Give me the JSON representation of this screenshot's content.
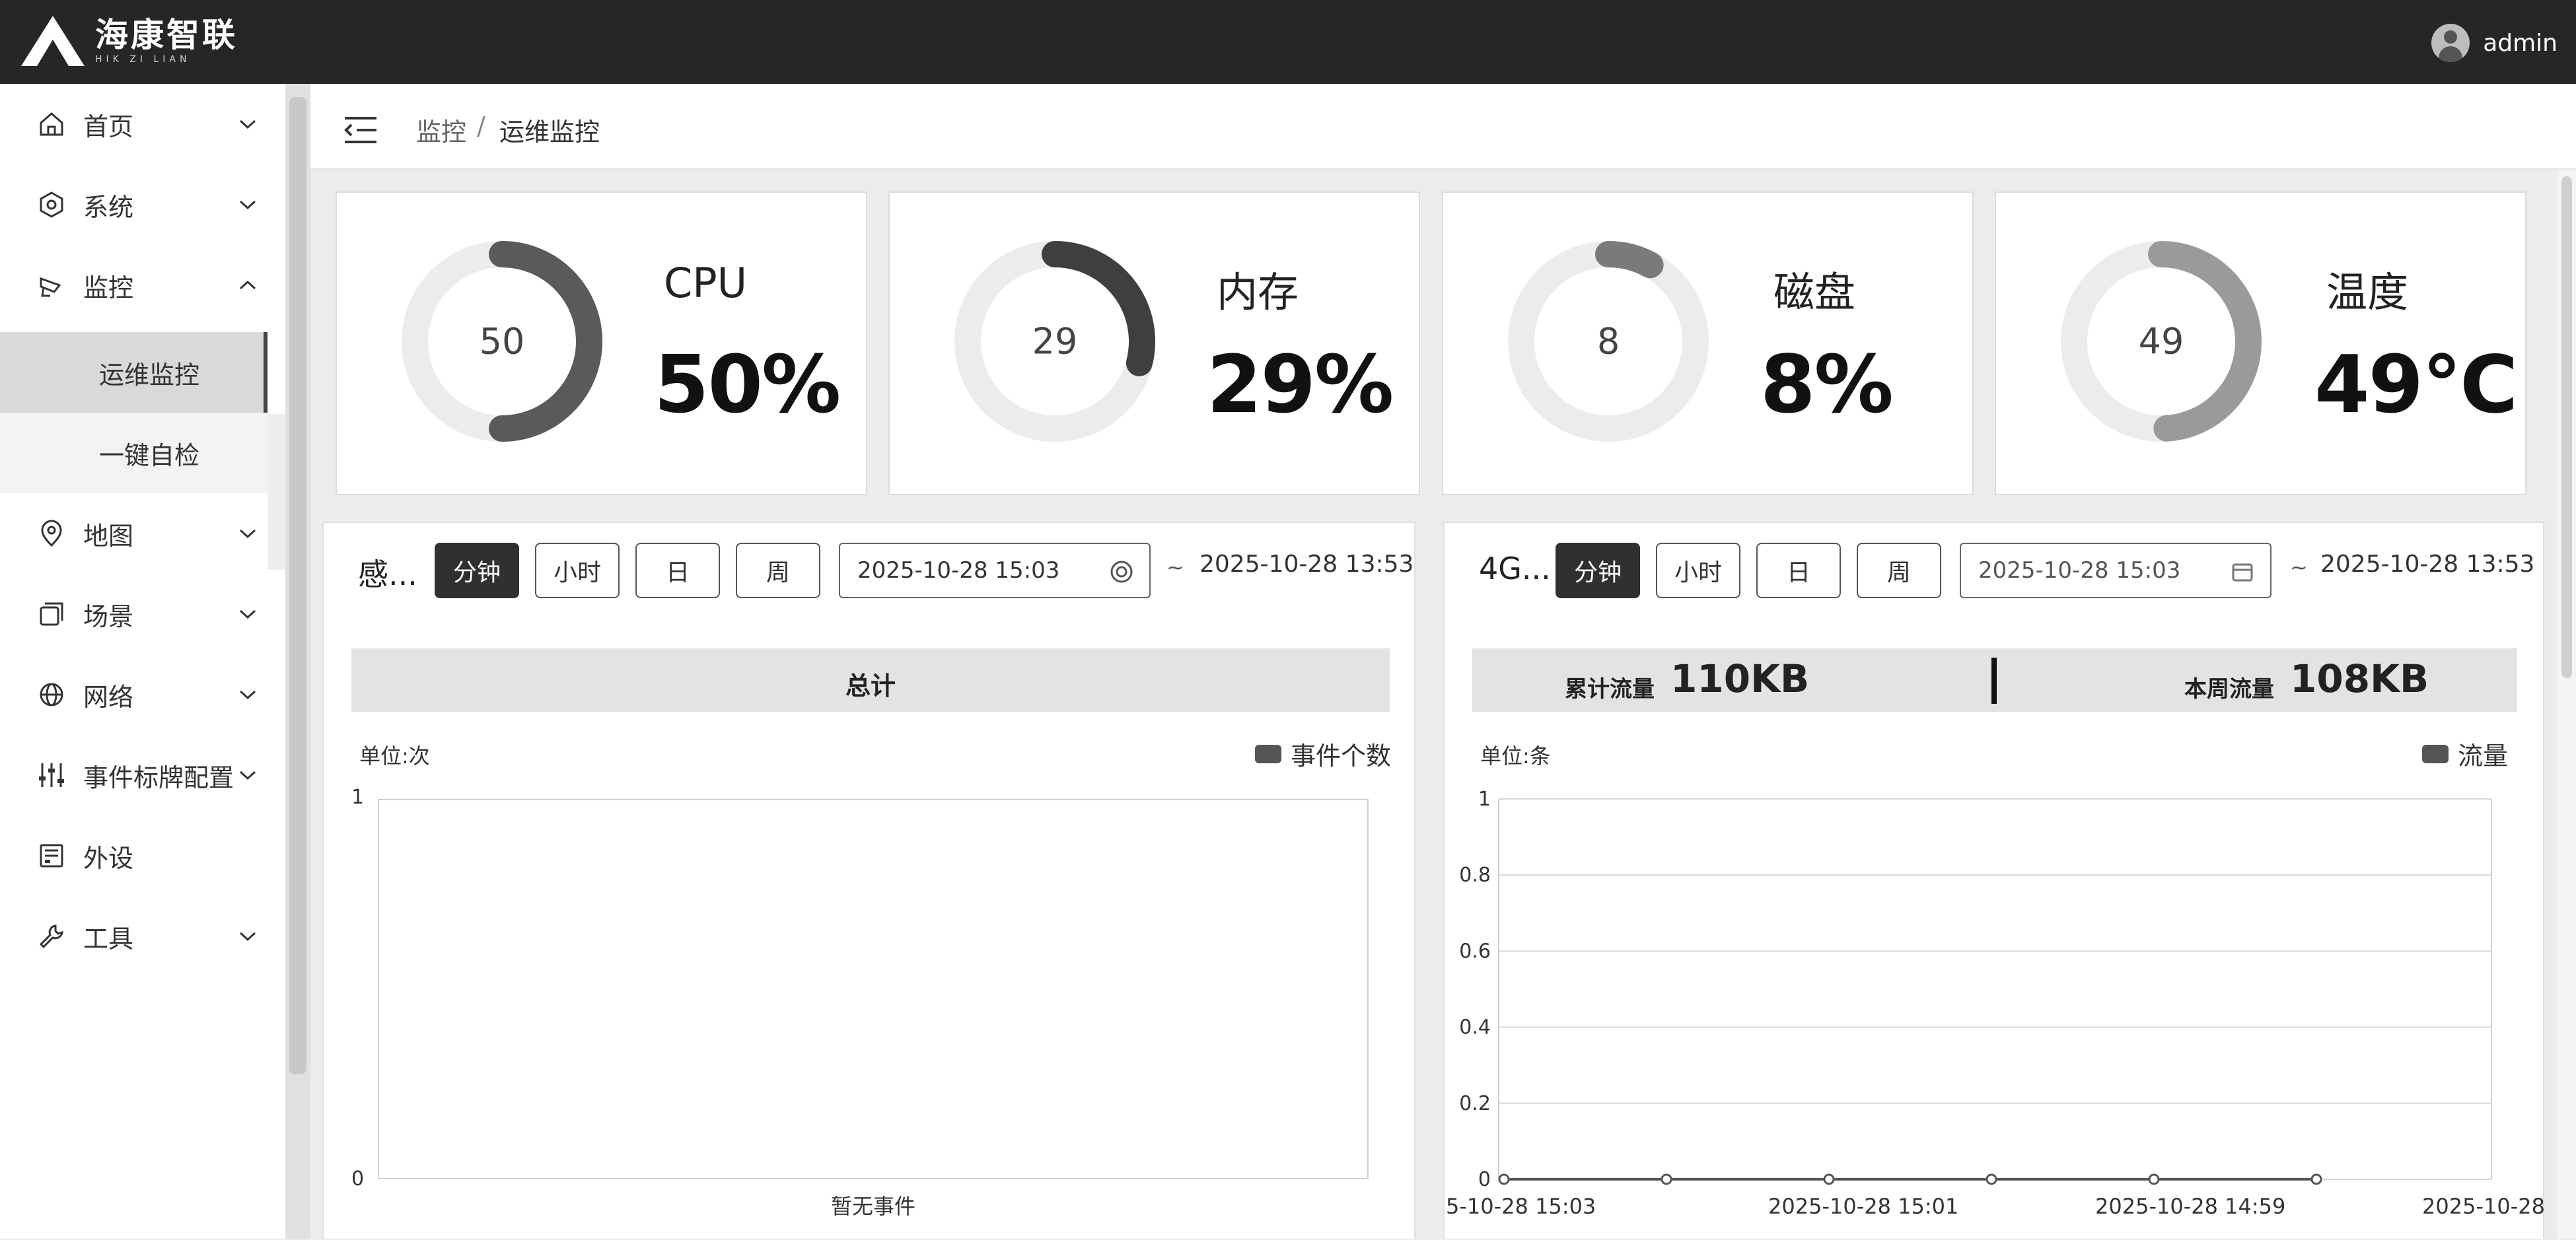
{
  "app": {
    "title": "海康智联",
    "subtitle": "HIK ZI LIAN",
    "user": "admin"
  },
  "sidebar": {
    "items": [
      {
        "label": "首页",
        "icon": "home-icon",
        "expanded": false
      },
      {
        "label": "系统",
        "icon": "gear-icon",
        "expanded": false
      },
      {
        "label": "监控",
        "icon": "camera-icon",
        "expanded": true,
        "children": [
          {
            "label": "运维监控",
            "active": true
          },
          {
            "label": "一键自检",
            "active": false
          }
        ]
      },
      {
        "label": "地图",
        "icon": "map-icon",
        "expanded": false
      },
      {
        "label": "场景",
        "icon": "scene-icon",
        "expanded": false
      },
      {
        "label": "网络",
        "icon": "globe-icon",
        "expanded": false
      },
      {
        "label": "事件标牌配置",
        "icon": "sliders-icon",
        "expanded": false
      },
      {
        "label": "外设",
        "icon": "device-icon",
        "expanded": null
      },
      {
        "label": "工具",
        "icon": "wrench-icon",
        "expanded": false
      }
    ]
  },
  "breadcrumb": {
    "parent": "监控",
    "separator": "/",
    "current": "运维监控"
  },
  "stats": [
    {
      "title": "CPU",
      "gauge": "50",
      "value": "50%",
      "percent": 50,
      "color": "#5a5a5a"
    },
    {
      "title": "内存",
      "gauge": "29",
      "value": "29%",
      "percent": 29,
      "color": "#3f3f3f"
    },
    {
      "title": "磁盘",
      "gauge": "8",
      "value": "8%",
      "percent": 8,
      "color": "#7a7a7a"
    },
    {
      "title": "温度",
      "gauge": "49",
      "value": "49℃",
      "percent": 49,
      "color": "#9a9a9a"
    }
  ],
  "left_panel": {
    "title": "感...",
    "buttons": [
      "分钟",
      "小时",
      "日",
      "周"
    ],
    "active_button": "分钟",
    "start": "2025-10-28 15:03",
    "tilde": "~",
    "end": "2025-10-28 13:53",
    "summary": "总计",
    "unit": "单位:次",
    "legend": "事件个数",
    "y_ticks": [
      "1",
      "0"
    ],
    "x_label": "暂无事件"
  },
  "right_panel": {
    "title": "4G...",
    "buttons": [
      "分钟",
      "小时",
      "日",
      "周"
    ],
    "active_button": "分钟",
    "start": "2025-10-28 15:03",
    "tilde": "~",
    "end": "2025-10-28 13:53",
    "total_label": "累计流量",
    "total_value": "110KB",
    "week_label": "本周流量",
    "week_value": "108KB",
    "unit": "单位:条",
    "legend": "流量",
    "y_ticks": [
      "1",
      "0.8",
      "0.6",
      "0.4",
      "0.2",
      "0"
    ],
    "x_labels": [
      "5-10-28 15:03",
      "2025-10-28 15:01",
      "2025-10-28 14:59",
      "2025-10-28"
    ]
  },
  "chart_data": {
    "type": "line",
    "ylabel": "单位:条",
    "ylim": [
      0,
      1
    ],
    "x": [
      "5-10-28 15:03",
      "",
      "2025-10-28 15:01",
      "",
      "2025-10-28 14:59",
      ""
    ],
    "series": [
      {
        "name": "流量",
        "values": [
          0,
          0,
          0,
          0,
          0,
          0
        ]
      }
    ]
  }
}
